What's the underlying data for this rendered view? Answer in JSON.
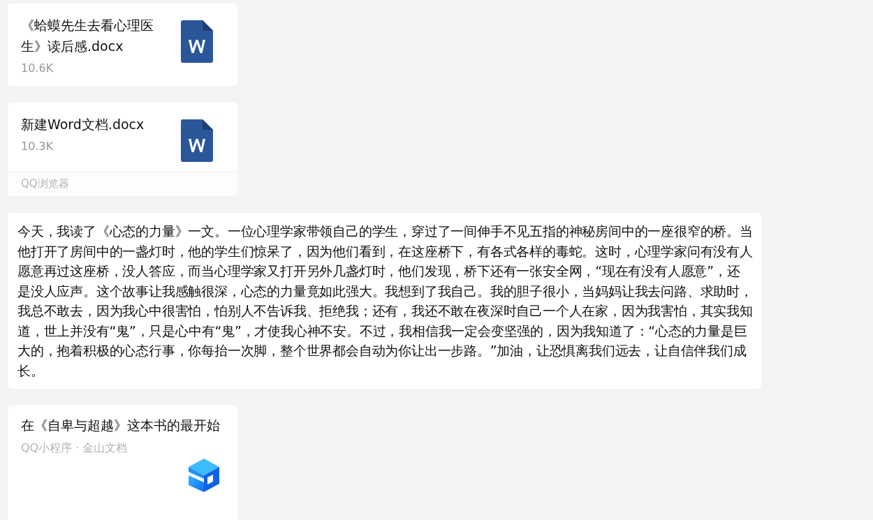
{
  "messages": [
    {
      "kind": "file",
      "name": "《蛤蟆先生去看心理医生》读后感.docx",
      "size": "10.6K"
    },
    {
      "kind": "file",
      "name": "新建Word文档.docx",
      "size": "10.3K",
      "source": "QQ浏览器"
    },
    {
      "kind": "text",
      "text": "今天，我读了《心态的力量》一文。一位心理学家带领自己的学生，穿过了一间伸手不见五指的神秘房间中的一座很窄的桥。当他打开了房间中的一盏灯时，他的学生们惊呆了，因为他们看到，在这座桥下，有各式各样的毒蛇。这时，心理学家问有没有人愿意再过这座桥，没人答应，而当心理学家又打开另外几盏灯时，他们发现，桥下还有一张安全网，“现在有没有人愿意”，还是没人应声。这个故事让我感触很深，心态的力量竟如此强大。我想到了我自己。我的胆子很小，当妈妈让我去问路、求助时，我总不敢去，因为我心中很害怕，怕别人不告诉我、拒绝我；还有，我还不敢在夜深时自己一个人在家，因为我害怕，其实我知道，世上并没有“鬼”，只是心中有“鬼”，才使我心神不安。不过，我相信我一定会变坚强的，因为我知道了：“心态的力量是巨大的，抱着积极的心态行事，你每抬一次脚，整个世界都会自动为你让出一步路。”加油，让恐惧离我们远去，让自信伴我们成长。"
    },
    {
      "kind": "miniapp",
      "title": "在《自卑与超越》这本书的最开始",
      "source": "QQ小程序 · 金山文档"
    }
  ]
}
